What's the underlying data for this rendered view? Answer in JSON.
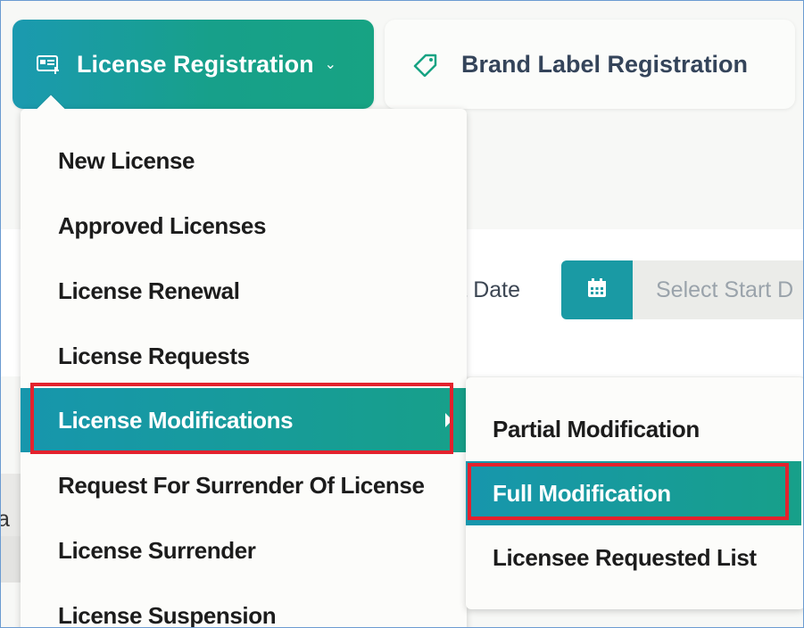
{
  "tabs": {
    "license_registration": {
      "label": "License Registration",
      "icon": "id-card-icon"
    },
    "brand_label_registration": {
      "label": "Brand Label Registration",
      "icon": "tag-icon"
    }
  },
  "filter": {
    "start_date_label": "rt Date",
    "start_date_placeholder": "Select Start D"
  },
  "background_fragment": "a",
  "menu": {
    "items": [
      {
        "label": "New License"
      },
      {
        "label": "Approved Licenses"
      },
      {
        "label": "License Renewal"
      },
      {
        "label": "License Requests"
      },
      {
        "label": "License Modifications",
        "active": true,
        "has_submenu": true
      },
      {
        "label": "Request For Surrender Of License"
      },
      {
        "label": "License Surrender"
      },
      {
        "label": "License Suspension"
      }
    ]
  },
  "submenu": {
    "items": [
      {
        "label": "Partial Modification"
      },
      {
        "label": "Full Modification",
        "active": true
      },
      {
        "label": "Licensee Requested List"
      }
    ]
  },
  "colors": {
    "accent_start": "#1796ad",
    "accent_end": "#17a089",
    "highlight": "#e3222d"
  }
}
